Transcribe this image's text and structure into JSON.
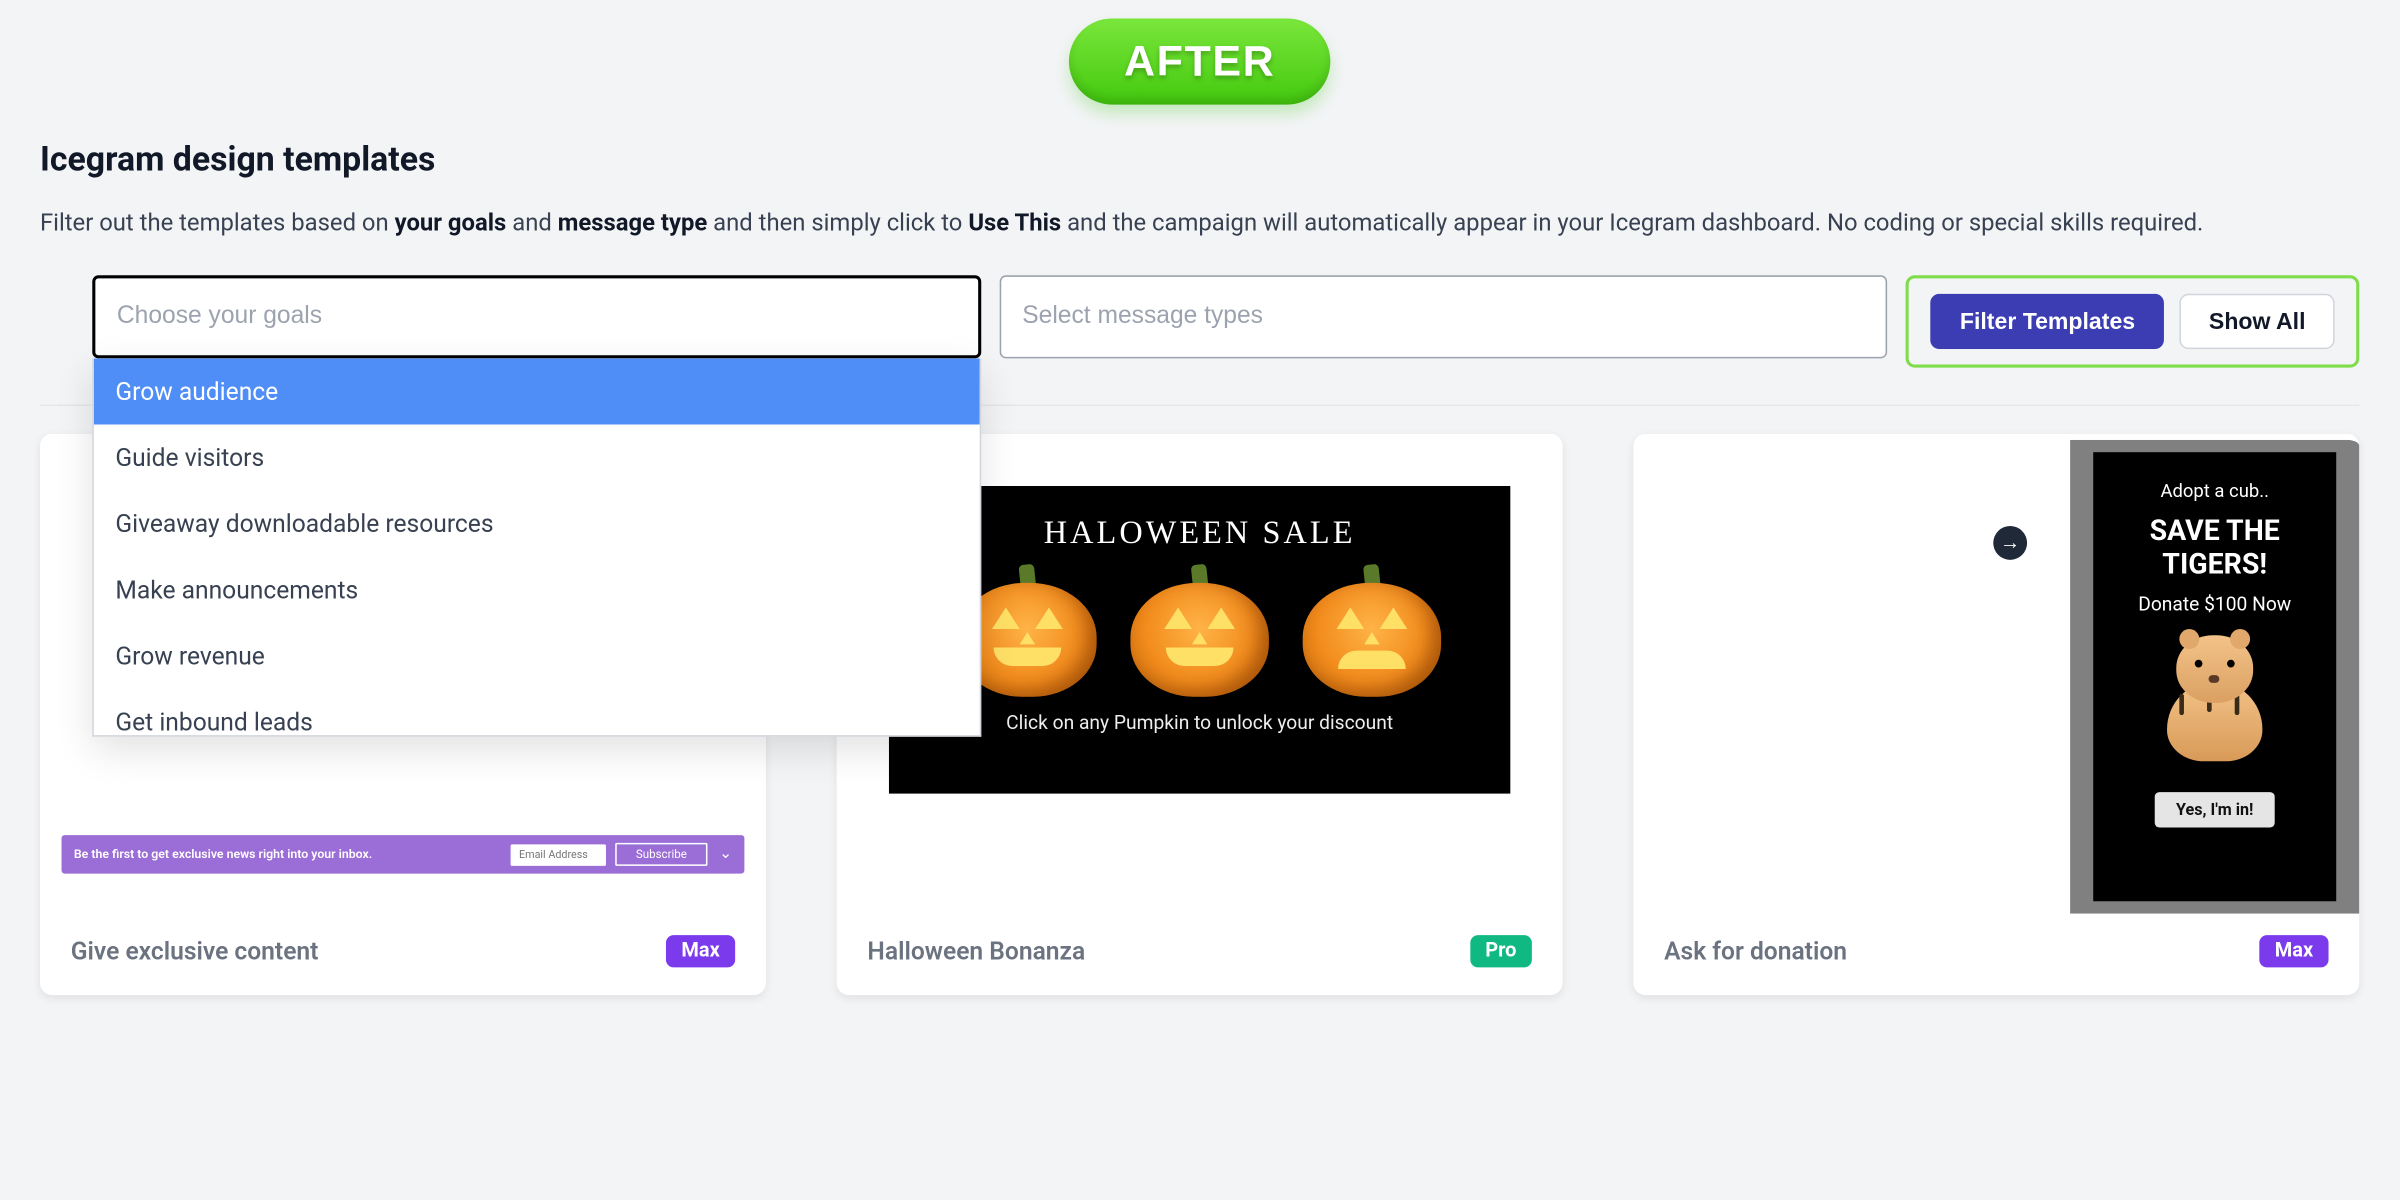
{
  "banner": {
    "label": "AFTER"
  },
  "header": {
    "title": "Icegram design templates",
    "desc_parts": {
      "p1": "Filter out the templates based on ",
      "b1": "your goals",
      "p2": " and ",
      "b2": "message type",
      "p3": " and then simply click to ",
      "b3": "Use This",
      "p4": " and the campaign will automatically appear in your Icegram dashboard. No coding or special skills required."
    }
  },
  "filters": {
    "goals_placeholder": "Choose your goals",
    "types_placeholder": "Select message types",
    "goals_options": [
      "Grow audience",
      "Guide visitors",
      "Giveaway downloadable resources",
      "Make announcements",
      "Grow revenue",
      "Get inbound leads"
    ],
    "highlighted_index": 0
  },
  "actions": {
    "filter_label": "Filter Templates",
    "show_all_label": "Show All"
  },
  "cards": [
    {
      "title": "Give exclusive content",
      "badge": "Max",
      "badge_class": "badge-max",
      "preview": {
        "bar_text": "Be the first to get exclusive news right into your inbox.",
        "input_placeholder": "Email Address",
        "button_label": "Subscribe"
      }
    },
    {
      "title": "Halloween Bonanza",
      "badge": "Pro",
      "badge_class": "badge-pro",
      "preview": {
        "headline": "HALOWEEN SALE",
        "sub": "Click on any Pumpkin to unlock your discount"
      }
    },
    {
      "title": "Ask for donation",
      "badge": "Max",
      "badge_class": "badge-max",
      "preview": {
        "adopt": "Adopt a cub..",
        "save": "SAVE THE TIGERS!",
        "donate": "Donate $100 Now",
        "cta": "Yes, I'm in!"
      }
    }
  ]
}
